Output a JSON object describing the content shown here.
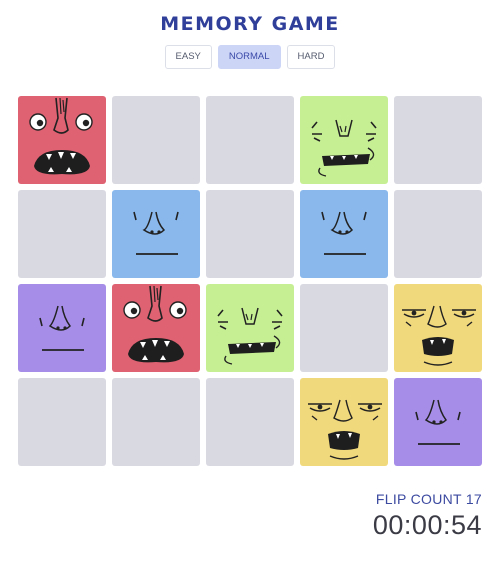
{
  "title": "MEMORY GAME",
  "difficulty": {
    "options": [
      "EASY",
      "NORMAL",
      "HARD"
    ],
    "selected": "NORMAL"
  },
  "board": {
    "columns": 5,
    "rows": 4,
    "cards": [
      {
        "state": "up",
        "monster": "red"
      },
      {
        "state": "down"
      },
      {
        "state": "down"
      },
      {
        "state": "up",
        "monster": "green"
      },
      {
        "state": "down"
      },
      {
        "state": "down"
      },
      {
        "state": "up",
        "monster": "blue"
      },
      {
        "state": "down"
      },
      {
        "state": "up",
        "monster": "blue"
      },
      {
        "state": "down"
      },
      {
        "state": "up",
        "monster": "purple"
      },
      {
        "state": "up",
        "monster": "red"
      },
      {
        "state": "up",
        "monster": "green"
      },
      {
        "state": "down"
      },
      {
        "state": "up",
        "monster": "yellow"
      },
      {
        "state": "down"
      },
      {
        "state": "down"
      },
      {
        "state": "down"
      },
      {
        "state": "up",
        "monster": "yellow"
      },
      {
        "state": "up",
        "monster": "purple"
      }
    ]
  },
  "monster_colors": {
    "red": "#de6272",
    "green": "#c6ef94",
    "blue": "#8ab8ec",
    "purple": "#a68ee8",
    "yellow": "#f0d87c",
    "card_back": "#d9d9e1"
  },
  "flip_count_label": "FLIP COUNT 17",
  "timer": "00:00:54"
}
